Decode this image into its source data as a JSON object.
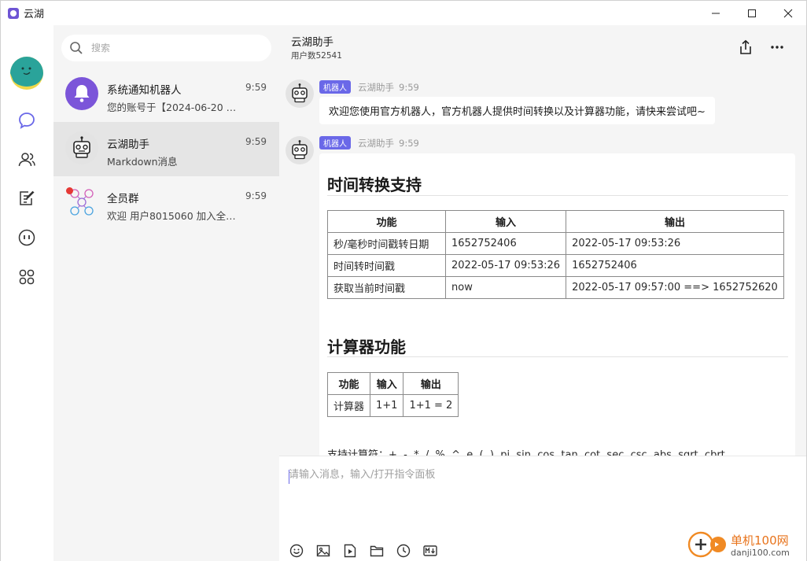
{
  "app": {
    "title": "云湖"
  },
  "search": {
    "placeholder": "搜索"
  },
  "conversations": [
    {
      "name": "系统通知机器人",
      "time": "9:59",
      "preview": "您的账号于【2024-06-20 …"
    },
    {
      "name": "云湖助手",
      "time": "9:59",
      "preview": "Markdown消息"
    },
    {
      "name": "全员群",
      "time": "9:59",
      "preview": "欢迎 用户8015060 加入全…"
    }
  ],
  "chat": {
    "title": "云湖助手",
    "subtitle": "用户数52541",
    "messages": [
      {
        "badge": "机器人",
        "sender": "云湖助手",
        "time": "9:59",
        "text": "欢迎您使用官方机器人，官方机器人提供时间转换以及计算器功能，请快来尝试吧~"
      },
      {
        "badge": "机器人",
        "sender": "云湖助手",
        "time": "9:59"
      }
    ],
    "markdown": {
      "heading1": "时间转换支持",
      "table1": {
        "headers": [
          "功能",
          "输入",
          "输出"
        ],
        "rows": [
          [
            "秒/毫秒时间戳转日期",
            "1652752406",
            "2022-05-17 09:53:26"
          ],
          [
            "时间转时间戳",
            "2022-05-17 09:53:26",
            "1652752406"
          ],
          [
            "获取当前时间戳",
            "now",
            "2022-05-17 09:57:00 ==> 1652752620"
          ]
        ]
      },
      "heading2": "计算器功能",
      "table2": {
        "headers": [
          "功能",
          "输入",
          "输出"
        ],
        "rows": [
          [
            "计算器",
            "1+1",
            "1+1 = 2"
          ]
        ]
      },
      "operators": "支持计算符：+, -, *, /, %, ^, e, (, ), pi, sin, cos, tan, cot, sec, csc, abs, sqrt, cbrt"
    }
  },
  "composer": {
    "placeholder": "请输入消息，输入/打开指令面板"
  },
  "watermark": {
    "text": "单机100网",
    "url": "danji100.com"
  },
  "colors": {
    "accent": "#6a68e8",
    "badge": "#6a68e8",
    "list_bg": "#f5f5f5",
    "active_row": "#e5e5e5"
  }
}
